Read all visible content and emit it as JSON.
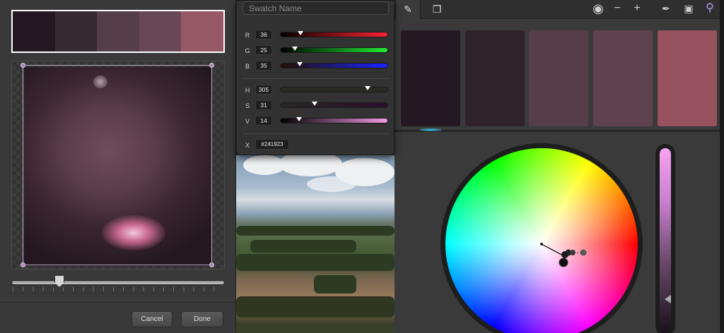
{
  "left": {
    "palette": [
      "#241923",
      "#352a32",
      "#553d4a",
      "#6a4756",
      "#975966"
    ],
    "slider_value": 0.22,
    "cancel_label": "Cancel",
    "done_label": "Done"
  },
  "popover": {
    "name_placeholder": "Swatch Name",
    "rows": {
      "r": {
        "label": "R",
        "value": "36"
      },
      "g": {
        "label": "G",
        "value": "25"
      },
      "b": {
        "label": "B",
        "value": "35"
      },
      "h": {
        "label": "H",
        "value": "305"
      },
      "s": {
        "label": "S",
        "value": "31"
      },
      "v": {
        "label": "V",
        "value": "14"
      }
    },
    "hex_label": "X",
    "hex_value": "#241923"
  },
  "right": {
    "tabs": [
      {
        "icon": "pencil-icon",
        "active": true
      },
      {
        "icon": "layers-icon",
        "active": false
      }
    ],
    "tools": [
      "eye-icon",
      "minus-icon",
      "plus-icon",
      "eyedropper-icon",
      "camera-icon",
      "magnifier-icon"
    ],
    "swatches": [
      "#241923",
      "#2f2229",
      "#553d4a",
      "#5e4250",
      "#96525f"
    ],
    "selected_swatch_index": 0
  }
}
